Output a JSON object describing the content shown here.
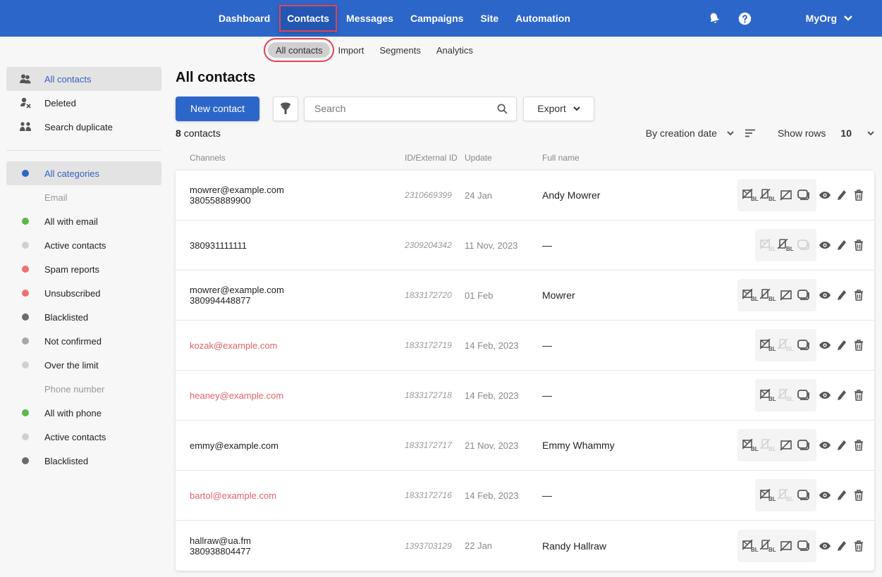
{
  "topnav": {
    "items": [
      {
        "label": "Dashboard",
        "active": false
      },
      {
        "label": "Contacts",
        "active": true
      },
      {
        "label": "Messages",
        "active": false
      },
      {
        "label": "Campaigns",
        "active": false
      },
      {
        "label": "Site",
        "active": false
      },
      {
        "label": "Automation",
        "active": false
      }
    ],
    "icons": [
      "bell-icon",
      "help-icon"
    ],
    "org": "MyOrg"
  },
  "subnav": {
    "items": [
      {
        "label": "All contacts",
        "active": true
      },
      {
        "label": "Import",
        "active": false
      },
      {
        "label": "Segments",
        "active": false
      },
      {
        "label": "Analytics",
        "active": false
      }
    ]
  },
  "sidebar": {
    "top": [
      {
        "label": "All contacts",
        "icon": "users-icon",
        "active": true
      },
      {
        "label": "Deleted",
        "icon": "user-deleted-icon",
        "active": false
      },
      {
        "label": "Search duplicate",
        "icon": "duplicate-users-icon",
        "active": false
      }
    ],
    "all_categories": {
      "label": "All categories",
      "color": "#2d66c9",
      "active": true
    },
    "email_group": "Email",
    "email": [
      {
        "label": "All with email",
        "color": "#5cb84a"
      },
      {
        "label": "Active contacts",
        "color": "#d0d0d0"
      },
      {
        "label": "Spam reports",
        "color": "#ef6f72"
      },
      {
        "label": "Unsubscribed",
        "color": "#ef6f72"
      },
      {
        "label": "Blacklisted",
        "color": "#6b6b6b"
      },
      {
        "label": "Not confirmed",
        "color": "#a8a8a8"
      },
      {
        "label": "Over the limit",
        "color": "#d0d0d0"
      }
    ],
    "phone_group": "Phone number",
    "phone": [
      {
        "label": "All with phone",
        "color": "#5cb84a"
      },
      {
        "label": "Active contacts",
        "color": "#d0d0d0"
      },
      {
        "label": "Blacklisted",
        "color": "#6b6b6b"
      }
    ]
  },
  "main": {
    "title": "All contacts",
    "new_contact": "New contact",
    "search_placeholder": "Search",
    "export": "Export",
    "count": "8",
    "count_label": "contacts",
    "sort": "By creation date",
    "show_rows_label": "Show rows",
    "show_rows_value": "10",
    "columns": {
      "channels": "Channels",
      "id": "ID/External ID",
      "update": "Update",
      "name": "Full name"
    }
  },
  "rows": [
    {
      "email": "mowrer@example.com",
      "phone": "380558889900",
      "email_red": false,
      "id": "2310669399",
      "update": "24 Jan",
      "name": "Andy Mowrer",
      "channels": [
        "email-bl",
        "phone-bl",
        "sms",
        "messenger"
      ],
      "dim": [],
      "wide": true
    },
    {
      "email": "",
      "phone": "380931111111",
      "email_red": false,
      "id": "2309204342",
      "update": "11 Nov, 2023",
      "name": "—",
      "channels": [
        "email-bl",
        "phone-bl",
        "messenger"
      ],
      "dim": [
        0,
        2
      ],
      "wide": false
    },
    {
      "email": "mowrer@example.com",
      "phone": "380994448877",
      "email_red": false,
      "id": "1833172720",
      "update": "01 Feb",
      "name": "Mowrer",
      "channels": [
        "email-bl",
        "phone-bl",
        "sms",
        "messenger"
      ],
      "dim": [],
      "wide": true
    },
    {
      "email": "kozak@example.com",
      "phone": "",
      "email_red": true,
      "id": "1833172719",
      "update": "14 Feb, 2023",
      "name": "—",
      "channels": [
        "email-bl",
        "phone-bl",
        "messenger"
      ],
      "dim": [
        1
      ],
      "wide": false
    },
    {
      "email": "heaney@example.com",
      "phone": "",
      "email_red": true,
      "id": "1833172718",
      "update": "14 Feb, 2023",
      "name": "—",
      "channels": [
        "email-bl",
        "phone-bl",
        "messenger"
      ],
      "dim": [
        1
      ],
      "wide": false
    },
    {
      "email": "emmy@example.com",
      "phone": "",
      "email_red": false,
      "id": "1833172717",
      "update": "21 Nov, 2023",
      "name": "Emmy Whammy",
      "channels": [
        "email-bl",
        "phone-bl",
        "sms",
        "messenger"
      ],
      "dim": [
        1
      ],
      "wide": true
    },
    {
      "email": "bartol@example.com",
      "phone": "",
      "email_red": true,
      "id": "1833172716",
      "update": "14 Feb, 2023",
      "name": "—",
      "channels": [
        "email-bl",
        "phone-bl",
        "messenger"
      ],
      "dim": [
        1
      ],
      "wide": false
    },
    {
      "email": "hallraw@ua.fm",
      "phone": "380938804477",
      "email_red": false,
      "id": "1393703129",
      "update": "22 Jan",
      "name": "Randy Hallraw",
      "channels": [
        "email-bl",
        "phone-bl",
        "sms",
        "messenger"
      ],
      "dim": [],
      "wide": true
    }
  ]
}
